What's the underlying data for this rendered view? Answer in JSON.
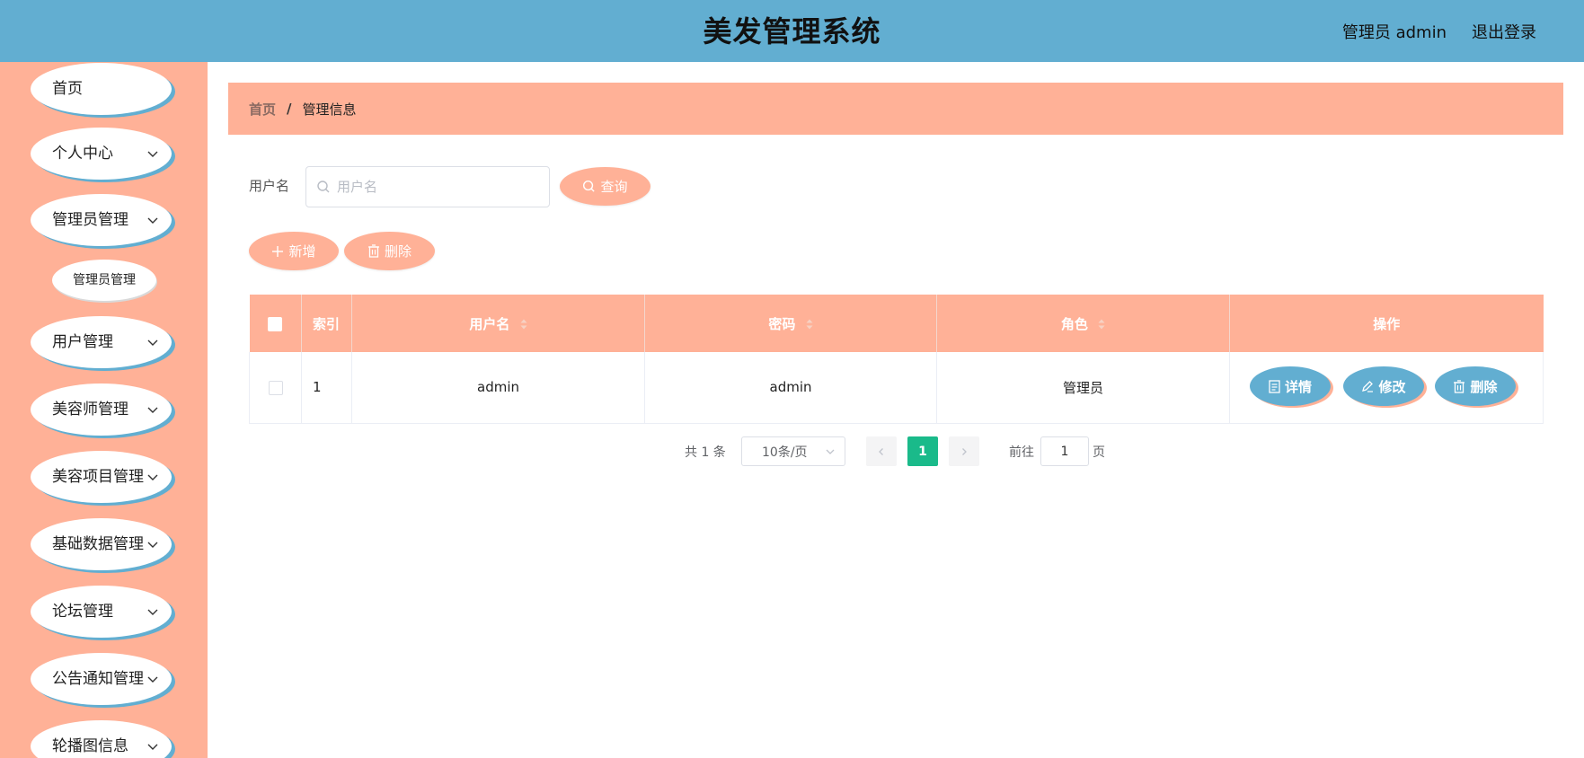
{
  "header": {
    "title": "美发管理系统",
    "user_label": "管理员 admin",
    "logout_label": "退出登录",
    "bg_color": "#62aed1"
  },
  "sidebar": {
    "bg_color": "#ffb197",
    "items": [
      {
        "label": "首页",
        "has_arrow": false
      },
      {
        "label": "个人中心",
        "has_arrow": true
      },
      {
        "label": "管理员管理",
        "has_arrow": true
      },
      {
        "label": "用户管理",
        "has_arrow": true
      },
      {
        "label": "美容师管理",
        "has_arrow": true
      },
      {
        "label": "美容项目管理",
        "has_arrow": true
      },
      {
        "label": "基础数据管理",
        "has_arrow": true
      },
      {
        "label": "论坛管理",
        "has_arrow": true
      },
      {
        "label": "公告通知管理",
        "has_arrow": true
      },
      {
        "label": "轮播图信息",
        "has_arrow": true
      }
    ],
    "submenu": {
      "label": "管理员管理"
    }
  },
  "breadcrumb": {
    "home": "首页",
    "separator": "/",
    "current": "管理信息"
  },
  "search": {
    "label": "用户名",
    "placeholder": "用户名",
    "value": "",
    "query_label": "查询"
  },
  "actions": {
    "add_label": "新增",
    "delete_label": "删除"
  },
  "table": {
    "columns": [
      "",
      "索引",
      "用户名",
      "密码",
      "角色",
      "操作"
    ],
    "rows": [
      {
        "index": "1",
        "username": "admin",
        "password": "admin",
        "role": "管理员"
      }
    ],
    "row_actions": {
      "detail": "详情",
      "edit": "修改",
      "delete": "删除"
    }
  },
  "pagination": {
    "total_text": "共 1 条",
    "page_size": "10条/页",
    "current_page": "1",
    "goto_prefix": "前往",
    "goto_value": "1",
    "goto_suffix": "页",
    "active_color": "#1aba8a"
  }
}
